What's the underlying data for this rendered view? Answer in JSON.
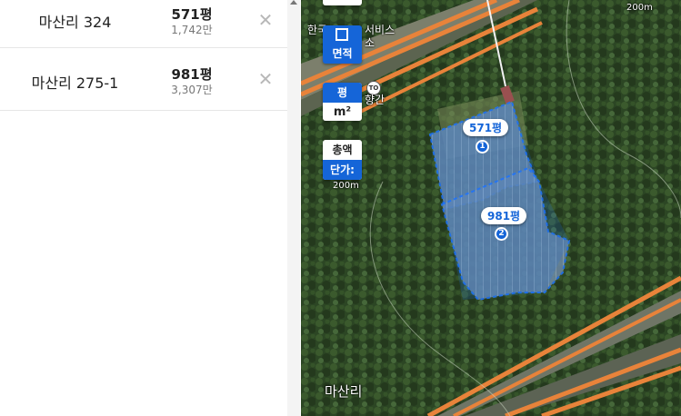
{
  "parcels": [
    {
      "name": "마산리 324",
      "area": "571평",
      "price": "1,742만",
      "map_label": "571평",
      "number": "1"
    },
    {
      "name": "마산리 275-1",
      "area": "981평",
      "price": "3,307만",
      "map_label": "981평",
      "number": "2"
    }
  ],
  "controls": {
    "area_tool": "면적",
    "unit_pyeong": "평",
    "unit_m2": "m²",
    "total_price": "총액",
    "unit_price": "단가:"
  },
  "map_labels": {
    "scale_top": "200m",
    "scale_left": "200m",
    "poi_line1": "한국",
    "poi_line2": "서비스",
    "poi_line3": "소",
    "gas_badge": "TO",
    "rest_area": "향간",
    "village": "마산리"
  },
  "colors": {
    "accent": "#1565d8",
    "road": "#e8833a"
  }
}
